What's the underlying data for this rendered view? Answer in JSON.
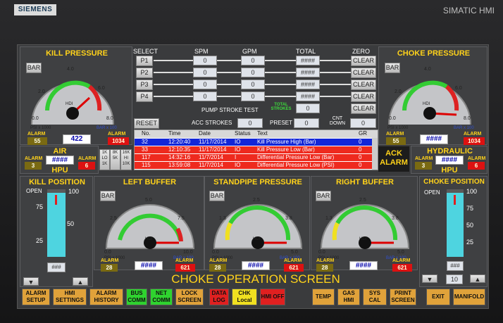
{
  "device": {
    "brand": "SIEMENS",
    "model": "SIMATIC HMI"
  },
  "screen_title": "CHOKE OPERATION SCREEN",
  "kill_pressure": {
    "title": "KILL PRESSURE",
    "bar_btn": "BAR",
    "scale": [
      "0.0",
      "2.0",
      "4.0",
      "6.0",
      "8.0"
    ],
    "inner_scale": [
      "0.0",
      "1.4",
      "2.8",
      "4.1",
      "5.5"
    ],
    "units_left": "PSI x 1000",
    "units_right": "BAR x 100",
    "center": "HDI",
    "value": "422",
    "alarm_label": "ALARM",
    "alarm_low": "55",
    "alarm_high": "1034"
  },
  "choke_pressure": {
    "title": "CHOKE PRESSURE",
    "bar_btn": "BAR",
    "scale": [
      "0.0",
      "2.0",
      "4.0",
      "6.0",
      "8.0"
    ],
    "inner_scale": [
      "0.0",
      "1.4",
      "2.8",
      "4.1",
      "5.5"
    ],
    "units_left": "PSI x 1000",
    "units_right": "BAR x 100",
    "center": "HDI",
    "value": "####",
    "alarm_label": "ALARM",
    "alarm_low": "55",
    "alarm_high": "1034"
  },
  "pumps": {
    "headers": {
      "select": "SELECT",
      "spm": "SPM",
      "gpm": "GPM",
      "total": "TOTAL",
      "zero": "ZERO"
    },
    "rows": [
      {
        "name": "P1",
        "spm": "0",
        "gpm": "0",
        "total": "####",
        "zero": "CLEAR"
      },
      {
        "name": "P2",
        "spm": "0",
        "gpm": "0",
        "total": "####",
        "zero": "CLEAR"
      },
      {
        "name": "P3",
        "spm": "0",
        "gpm": "0",
        "total": "####",
        "zero": "CLEAR"
      },
      {
        "name": "P4",
        "spm": "0",
        "gpm": "0",
        "total": "####",
        "zero": "CLEAR"
      }
    ],
    "stroke_test": "PUMP STROKE TEST",
    "total_strokes_label": "TOTAL STROKES",
    "total_strokes": "0",
    "total_clear": "CLEAR",
    "reset": "RESET",
    "acc_label": "ACC STROKES",
    "acc": "0",
    "preset_label": "PRESET",
    "preset": "0",
    "cnt_label": "CNT DOWN",
    "cnt": "0"
  },
  "alarms": {
    "headers": [
      "No.",
      "Time",
      "Date",
      "Status",
      "Text",
      "GR"
    ],
    "rows": [
      {
        "no": "32",
        "time": "12:20:40",
        "date": "11/17/2014",
        "status": "IO",
        "text": "Kill Pressure High (Bar)",
        "gr": "0"
      },
      {
        "no": "33",
        "time": "12:10:35",
        "date": "11/17/2014",
        "status": "IO",
        "text": "Kill Pressure Low (Bar)",
        "gr": "0"
      },
      {
        "no": "117",
        "time": "14:32:16",
        "date": "11/7/2014",
        "status": "I",
        "text": "Differential Pressure Low (Bar)",
        "gr": "0"
      },
      {
        "no": "115",
        "time": "13:59:08",
        "date": "11/7/2014",
        "status": "IO",
        "text": "Differential Pressure Low (PSI)",
        "gr": "0"
      }
    ],
    "ack": "ACK ALARM"
  },
  "air": {
    "title": "AIR",
    "value": "####",
    "alarm_label": "ALARM",
    "alarm_low": "3",
    "alarm_high": "6",
    "hpu": "HPU",
    "buttons": [
      "1K LO 1K",
      "8K 5K",
      "16K HI 10K"
    ]
  },
  "hydraulic": {
    "title": "HYDRAULIC",
    "value": "####",
    "alarm_label": "ALARM",
    "alarm_low": "3",
    "alarm_high": "6",
    "hpu": "HPU"
  },
  "kill_position": {
    "title": "KILL POSITION",
    "open": "OPEN",
    "scale": [
      "100",
      "75",
      "50",
      "25"
    ],
    "value": "###",
    "level": 0.95
  },
  "choke_position": {
    "title": "CHOKE POSITION",
    "open": "OPEN",
    "scale": [
      "100",
      "75",
      "50",
      "25"
    ],
    "value": "###",
    "setpoint": "10",
    "level": 0.95
  },
  "buffers": [
    {
      "title": "LEFT BUFFER",
      "bar_btn": "BAR",
      "scale": [
        "0.0",
        "2.5",
        "5.0",
        "7.5",
        "10.0"
      ],
      "inner_scale": [
        "0.0",
        "1.7",
        "3.4",
        "5.2",
        "6.9"
      ],
      "units_left": "PSI x 1000",
      "units_right": "BAR x 100",
      "center": "HDI",
      "value": "####",
      "alarm_label": "ALARM",
      "alarm_low": "28",
      "alarm_high": "621"
    },
    {
      "title": "STANDPIPE PRESSURE",
      "bar_btn": "BAR",
      "scale": [
        "0.0",
        "1.3",
        "2.5",
        "3.8",
        "5.0"
      ],
      "inner_scale": [
        "0.0",
        "0.9",
        "1.7",
        "2.6",
        "3.4"
      ],
      "units_left": "PSI x 1000",
      "units_right": "BAR x 100",
      "center": "HDI",
      "value": "####",
      "alarm_label": "ALARM",
      "alarm_low": "28",
      "alarm_high": "621"
    },
    {
      "title": "RIGHT BUFFER",
      "bar_btn": "BAR",
      "scale": [
        "0.0",
        "1.3",
        "2.5",
        "3.8",
        "5.0"
      ],
      "inner_scale": [
        "0.0",
        "0.9",
        "1.7",
        "2.6",
        "3.4"
      ],
      "units_left": "PSI x 1000",
      "units_right": "BAR x 100",
      "center": "HDI",
      "value": "####",
      "alarm_label": "ALARM",
      "alarm_low": "28",
      "alarm_high": "621"
    }
  ],
  "nav": [
    {
      "label": "ALARM SETUP",
      "color": "#e0a23a"
    },
    {
      "label": "HMI SETTINGS",
      "color": "#e0a23a"
    },
    {
      "label": "ALARM HISTORY",
      "color": "#e0a23a"
    },
    {
      "label": "BUS COMM",
      "color": "#2fd32f"
    },
    {
      "label": "NET COMM",
      "color": "#2fd32f"
    },
    {
      "label": "LOCK SCREEN",
      "color": "#e0a23a"
    },
    {
      "label": "DATA LOG",
      "color": "#e02020"
    },
    {
      "label": "CHK Local",
      "color": "#f0e020"
    },
    {
      "label": "HMI OFF",
      "color": "#e02020"
    },
    {
      "label": "TEMP",
      "color": "#e0a23a"
    },
    {
      "label": "GAS HMI",
      "color": "#e0a23a"
    },
    {
      "label": "SYS CAL",
      "color": "#e0a23a"
    },
    {
      "label": "PRINT SCREEN",
      "color": "#e0a23a"
    },
    {
      "label": "EXIT",
      "color": "#e0a23a"
    },
    {
      "label": "MANIFOLD",
      "color": "#e0a23a"
    }
  ]
}
